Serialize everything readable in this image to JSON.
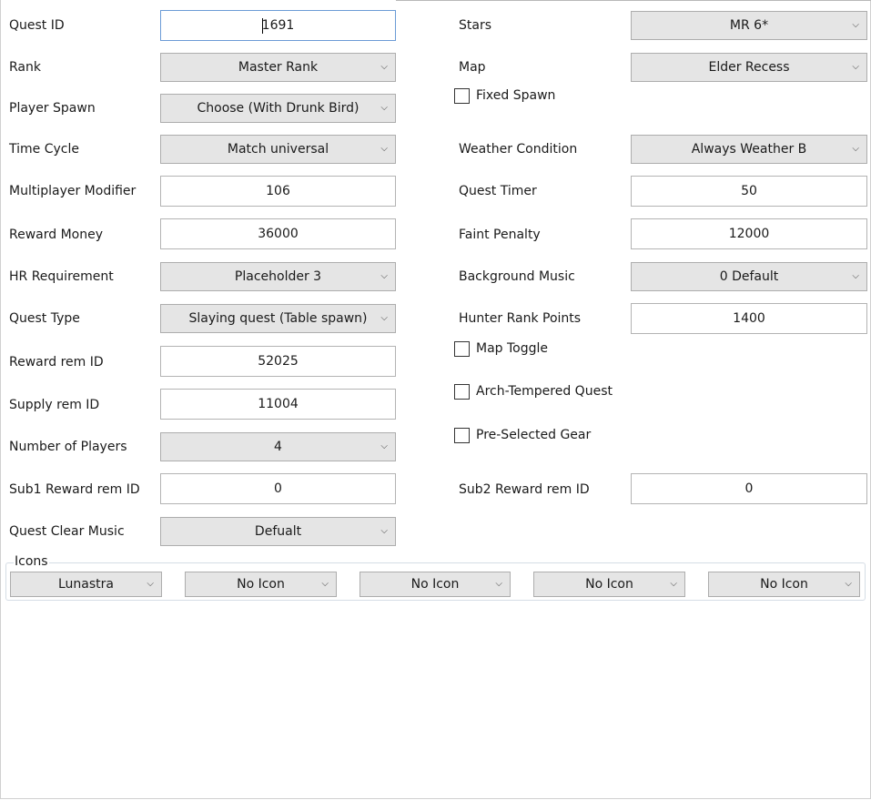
{
  "labels": {
    "quest_id": "Quest ID",
    "rank": "Rank",
    "player_spawn": "Player Spawn",
    "time_cycle": "Time Cycle",
    "multiplayer_modifier": "Multiplayer Modifier",
    "reward_money": "Reward Money",
    "hr_requirement": "HR Requirement",
    "quest_type": "Quest Type",
    "reward_rem_id": "Reward rem ID",
    "supply_rem_id": "Supply rem ID",
    "number_of_players": "Number of Players",
    "sub1_reward_rem_id": "Sub1 Reward rem ID",
    "quest_clear_music": "Quest Clear Music",
    "stars": "Stars",
    "map": "Map",
    "weather_condition": "Weather Condition",
    "quest_timer": "Quest Timer",
    "faint_penalty": "Faint Penalty",
    "background_music": "Background Music",
    "hunter_rank_points": "Hunter Rank Points",
    "sub2_reward_rem_id": "Sub2 Reward rem ID",
    "icons": "Icons"
  },
  "values": {
    "quest_id": "1691",
    "rank": "Master Rank",
    "player_spawn": "Choose (With Drunk Bird)",
    "time_cycle": "Match universal",
    "multiplayer_modifier": "106",
    "reward_money": "36000",
    "hr_requirement": "Placeholder 3",
    "quest_type": "Slaying quest (Table spawn)",
    "reward_rem_id": "52025",
    "supply_rem_id": "11004",
    "number_of_players": "4",
    "sub1_reward_rem_id": "0",
    "quest_clear_music": "Defualt",
    "stars": "MR 6*",
    "map": "Elder Recess",
    "weather_condition": "Always Weather B",
    "quest_timer": "50",
    "faint_penalty": "12000",
    "background_music": "0 Default",
    "hunter_rank_points": "1400",
    "sub2_reward_rem_id": "0"
  },
  "checkboxes": {
    "fixed_spawn": {
      "label": "Fixed Spawn",
      "checked": false
    },
    "map_toggle": {
      "label": "Map Toggle",
      "checked": false
    },
    "arch_tempered_quest": {
      "label": "Arch-Tempered Quest",
      "checked": false
    },
    "pre_selected_gear": {
      "label": "Pre-Selected Gear",
      "checked": false
    }
  },
  "icons": [
    "Lunastra",
    "No Icon",
    "No Icon",
    "No Icon",
    "No Icon"
  ],
  "dropdown_icon": "chevron-down-icon",
  "colors": {
    "combo_bg": "#e5e5e5",
    "focus_border": "#6b9bd6",
    "field_border": "#b3b3b3"
  }
}
